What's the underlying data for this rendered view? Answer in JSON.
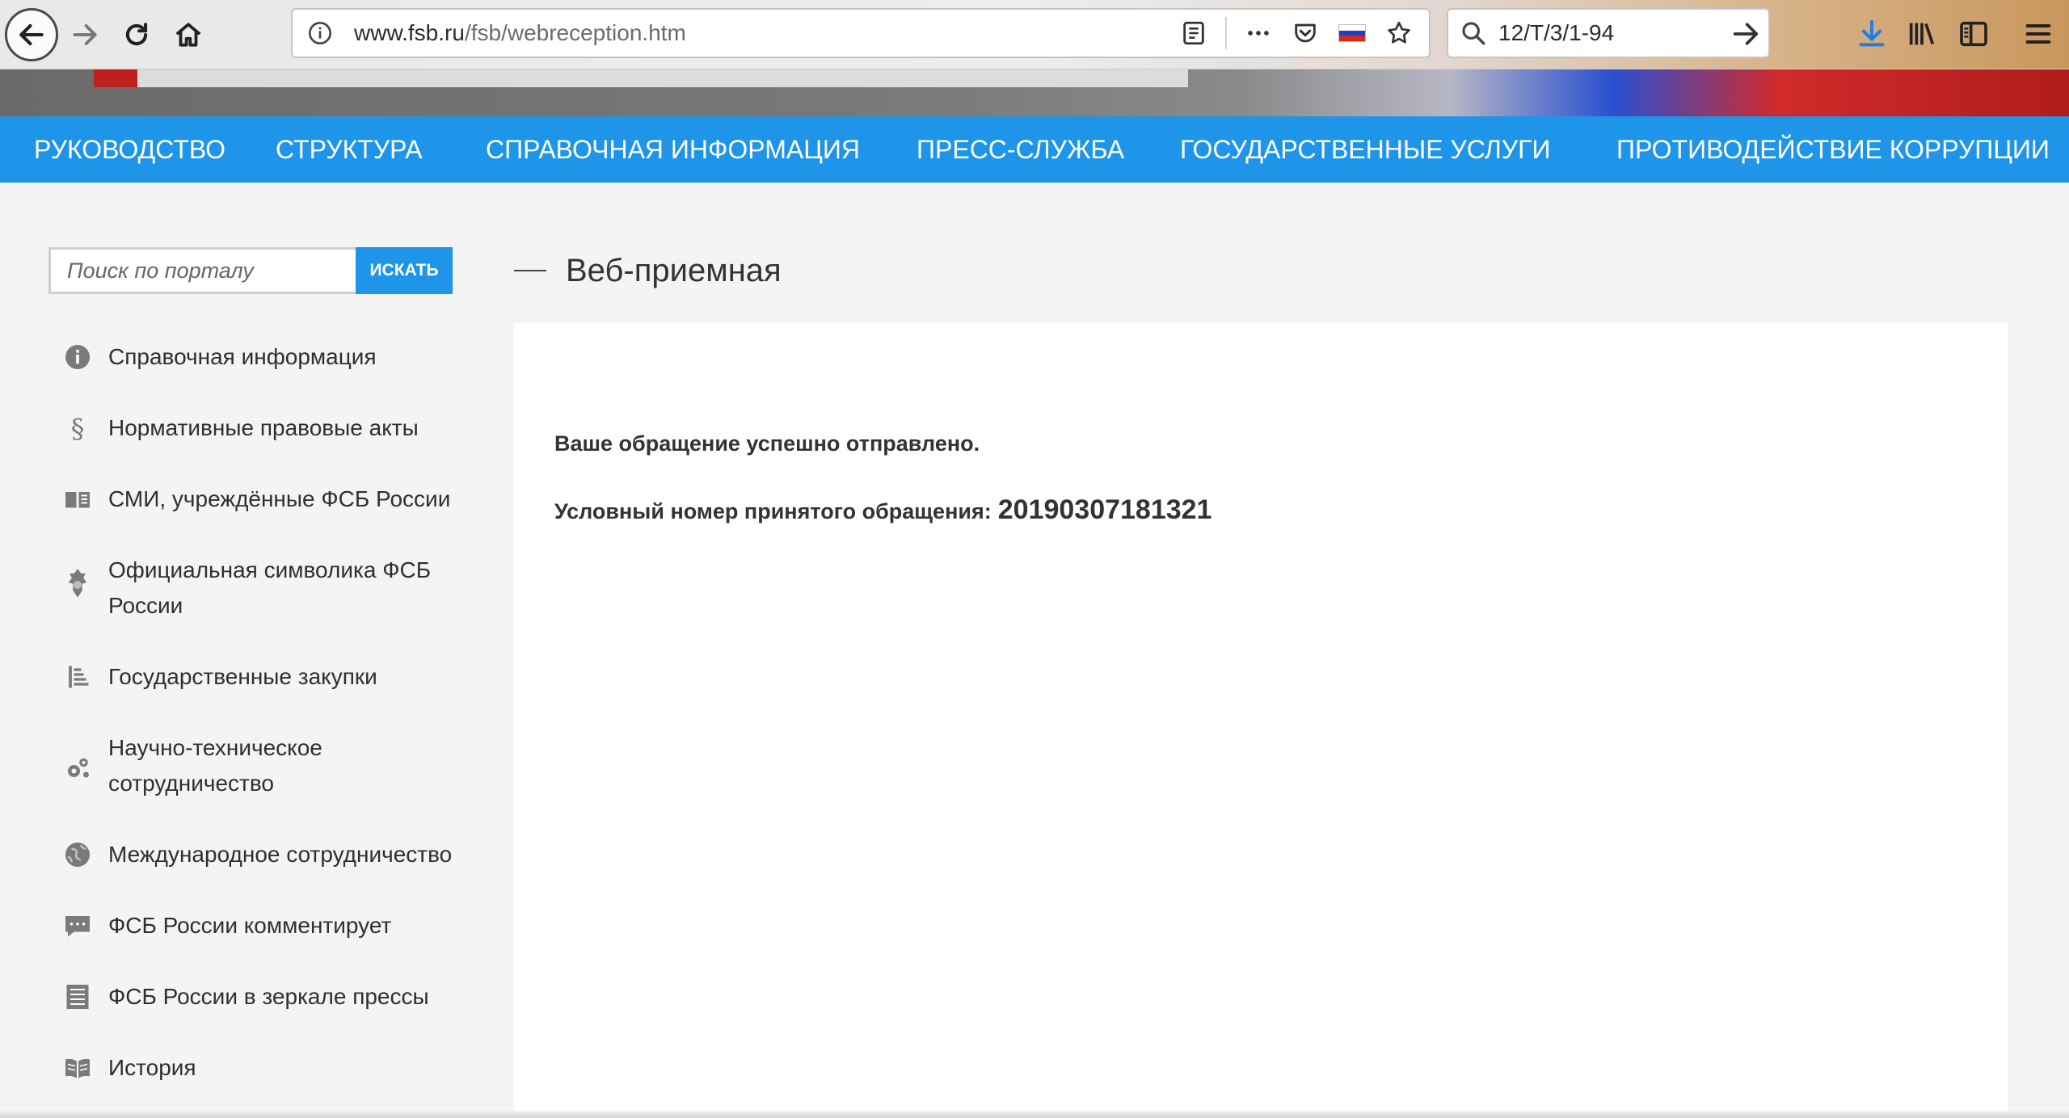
{
  "browser": {
    "url_host": "www.fsb.ru",
    "url_path": "/fsb/webreception.htm",
    "search_value": "12/T/3/1-94"
  },
  "nav": {
    "items": [
      {
        "label": "Руководство"
      },
      {
        "label": "Структура"
      },
      {
        "label": "Справочная информация"
      },
      {
        "label": "Пресс-служба"
      },
      {
        "label": "Государственные услуги"
      },
      {
        "label": "Противодействие коррупции"
      }
    ]
  },
  "search": {
    "placeholder": "Поиск по порталу",
    "button_label": "Искать"
  },
  "sidebar": {
    "items": [
      {
        "label": "Справочная информация",
        "icon": "info-icon"
      },
      {
        "label": "Нормативные правовые акты",
        "icon": "section-icon"
      },
      {
        "label": "СМИ, учреждённые ФСБ России",
        "icon": "book-icon"
      },
      {
        "label": "Официальная символика ФСБ России",
        "icon": "emblem-icon"
      },
      {
        "label": "Государственные закупки",
        "icon": "list-icon"
      },
      {
        "label": "Научно-техническое сотрудничество",
        "icon": "gears-icon"
      },
      {
        "label": "Международное сотрудничество",
        "icon": "globe-icon"
      },
      {
        "label": "ФСБ России комментирует",
        "icon": "comment-icon"
      },
      {
        "label": "ФСБ России в зеркале прессы",
        "icon": "newspaper-icon"
      },
      {
        "label": "История",
        "icon": "history-book-icon"
      }
    ]
  },
  "content": {
    "title": "Веб-приемная",
    "success_message": "Ваше обращение успешно отправлено.",
    "number_label": "Условный номер принятого обращения:",
    "number_value": "20190307181321"
  },
  "colors": {
    "accent": "#1e95e8",
    "panel": "#ffffff",
    "background": "#f4f4f4"
  }
}
